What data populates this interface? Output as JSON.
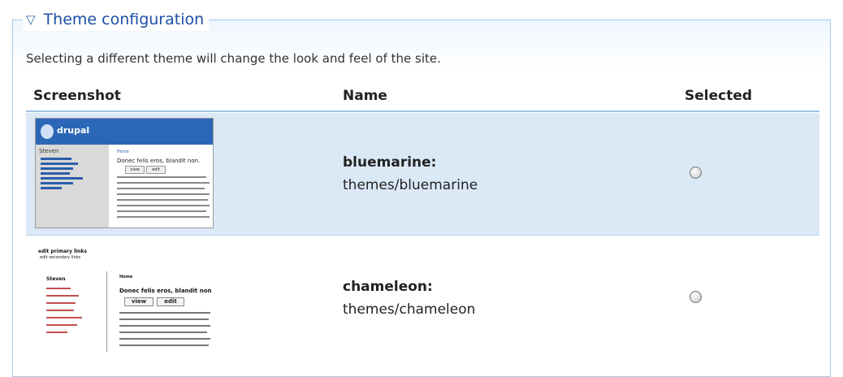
{
  "fieldset": {
    "legend_toggle": "▽",
    "legend": "Theme configuration"
  },
  "description": "Selecting a different theme will change the look and feel of the site.",
  "table": {
    "headers": [
      "Screenshot",
      "Name",
      "Selected"
    ],
    "rows": [
      {
        "name": "bluemarine:",
        "path": "themes/bluemarine",
        "selected": false,
        "thumb": {
          "brand": "drupal",
          "user": "Steven",
          "heading": "Home",
          "title": "Donec felis eros, blandit non.",
          "view": "view",
          "edit": "edit"
        }
      },
      {
        "name": "chameleon:",
        "path": "themes/chameleon",
        "selected": false,
        "thumb": {
          "primary": "edit primary links",
          "secondary": "edit secondary links",
          "user": "Steven",
          "heading": "Home",
          "title": "Donec felis eros, blandit non",
          "view": "view",
          "edit": "edit"
        }
      }
    ]
  }
}
